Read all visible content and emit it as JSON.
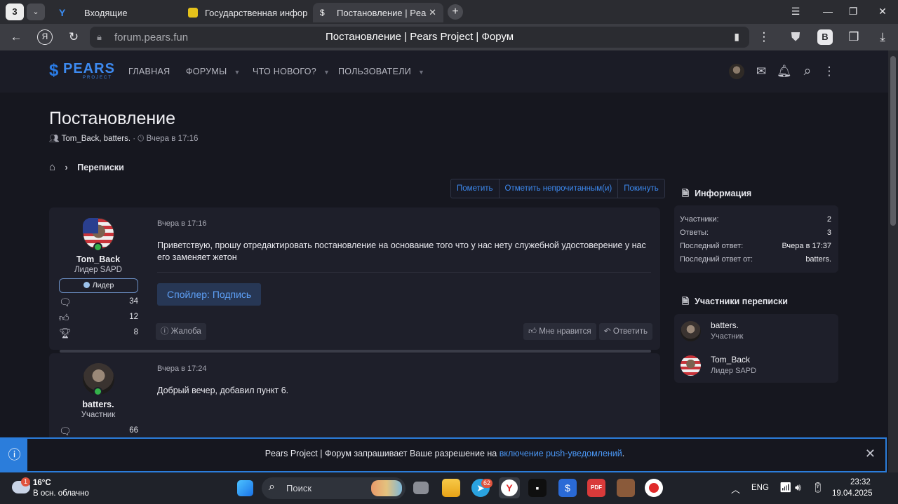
{
  "browser": {
    "tab_counter": "3",
    "tabs": [
      {
        "label": "Входящие"
      },
      {
        "label": "Государственная информ"
      },
      {
        "label": "Постановление | Pears"
      }
    ],
    "url": "forum.pears.fun",
    "page_title": "Постановление | Pears Project | Форум"
  },
  "site": {
    "logo_text": "PEARS",
    "logo_sub": "PROJECT",
    "nav": [
      {
        "label": "ГЛАВНАЯ"
      },
      {
        "label": "ФОРУМЫ"
      },
      {
        "label": "ЧТО НОВОГО?"
      },
      {
        "label": "ПОЛЬЗОВАТЕЛИ"
      }
    ]
  },
  "thread": {
    "title": "Постановление",
    "participants": "Tom_Back, batters.",
    "separator": "·",
    "time": "Вчера в 17:16",
    "breadcrumb": "Переписки",
    "actions": [
      "Пометить",
      "Отметить непрочитанным(и)",
      "Покинуть"
    ]
  },
  "posts": [
    {
      "author": "Tom_Back",
      "user_title": "Лидер SAPD",
      "badge": "Лидер",
      "stats": {
        "messages": "34",
        "reactions": "12",
        "trophies": "8"
      },
      "date": "Вчера в 17:16",
      "text": "Приветствую, прошу отредактировать постановление на основание того что у нас нету служебной удостоверение у нас его заменяет жетон",
      "spoiler": "Спойлер: Подпись",
      "report": "Жалоба",
      "like": "Мне нравится",
      "reply": "Ответить"
    },
    {
      "author": "batters.",
      "user_title": "Участник",
      "stats": {
        "messages": "66"
      },
      "date": "Вчера в 17:24",
      "text": "Добрый вечер, добавил пункт 6."
    }
  ],
  "sidebar": {
    "info_title": "Информация",
    "info_rows": [
      {
        "label": "Участники:",
        "value": "2"
      },
      {
        "label": "Ответы:",
        "value": "3"
      },
      {
        "label": "Последний ответ:",
        "value": "Вчера в 17:37"
      },
      {
        "label": "Последний ответ от:",
        "value": "batters."
      }
    ],
    "members_title": "Участники переписки",
    "members": [
      {
        "name": "batters.",
        "role": "Участник"
      },
      {
        "name": "Tom_Back",
        "role": "Лидер SAPD"
      }
    ]
  },
  "notification": {
    "text_before": "Pears Project | Форум запрашивает Ваше разрешение на ",
    "link": "включение push-уведомлений",
    "text_after": "."
  },
  "taskbar": {
    "weather_temp": "16°C",
    "weather_desc": "В осн. облачно",
    "weather_badge": "1",
    "search": "Поиск",
    "telegram_badge": "62",
    "lang": "ENG",
    "time": "23:32",
    "date": "19.04.2025"
  },
  "colors": {
    "accent": "#2b7ddb",
    "link": "#3d8af0",
    "background": "#16171f"
  }
}
